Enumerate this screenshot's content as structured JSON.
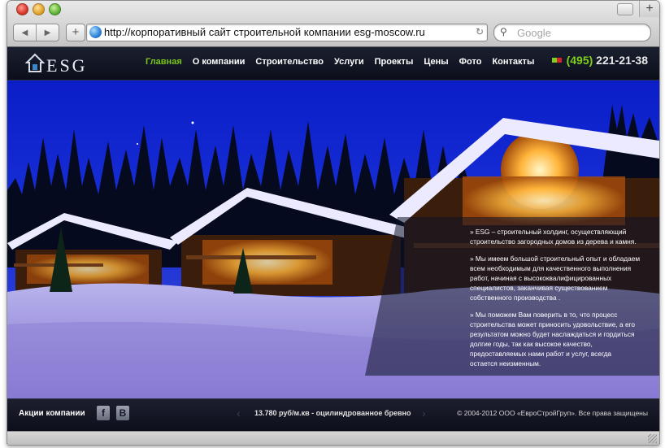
{
  "browser": {
    "url": "http://корпоративный сайт строительной компании esg-moscow.ru",
    "search_placeholder": "Google",
    "back_icon": "◀",
    "forward_icon": "▶",
    "add_icon": "+",
    "reload_icon": "↻",
    "newtab_icon": "+",
    "search_icon": "⚲"
  },
  "site": {
    "logo_text": "ESG",
    "nav": [
      {
        "label": "Главная",
        "active": true
      },
      {
        "label": "О компании"
      },
      {
        "label": "Строительство"
      },
      {
        "label": "Услуги"
      },
      {
        "label": "Проекты"
      },
      {
        "label": "Цены"
      },
      {
        "label": "Фото"
      },
      {
        "label": "Контакты"
      }
    ],
    "phone_code": "(495)",
    "phone_number": "221-21-38",
    "info": [
      "» ESG – строительный холдинг, осуществляющий строительство загородных домов из дерева и камня.",
      "» Мы имеем большой строительный опыт и обладаем всем необходимым для качественного выполнения работ, начиная с высококвалифицированных специалистов, заканчивая существованием собственного производства .",
      "» Мы поможем Вам поверить в то, что процесс строительства может приносить удовольствие, а его результатом можно будет наслаждаться и гордиться долгие годы, так как высокое качество, предоставляемых нами работ и услуг, всегда остается неизменным."
    ]
  },
  "footer": {
    "actions_label": "Акции компании",
    "fb_label": "f",
    "vk_label": "B",
    "price_text": "13.780 руб/м.кв - оцилиндрованное бревно",
    "prev_icon": "‹",
    "next_icon": "›",
    "copyright": "© 2004-2012 ООО «ЕвроСтройГруп». Все права защищены"
  }
}
